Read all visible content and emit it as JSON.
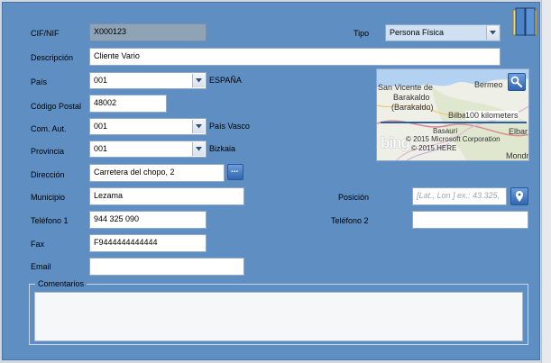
{
  "form": {
    "cif": {
      "label": "CIF/NIF",
      "value": "X000123"
    },
    "tipo": {
      "label": "Tipo",
      "value": "Persona Física"
    },
    "descripcion": {
      "label": "Descripción",
      "value": "Cliente Vario"
    },
    "pais": {
      "label": "País",
      "value": "001",
      "name": "ESPAÑA"
    },
    "codigo_postal": {
      "label": "Código Postal",
      "value": "48002"
    },
    "com_aut": {
      "label": "Com. Aut.",
      "value": "001",
      "name": "País Vasco"
    },
    "provincia": {
      "label": "Provincia",
      "value": "001",
      "name": "Bizkaia"
    },
    "direccion": {
      "label": "Dirección",
      "value": "Carretera del chopo, 2",
      "button": "..."
    },
    "municipio": {
      "label": "Municipio",
      "value": "Lezama"
    },
    "posicion": {
      "label": "Posición",
      "placeholder": "[Lat., Lon ] ex.: 43.325,"
    },
    "telefono1": {
      "label": "Teléfono 1",
      "value": "944 325 090"
    },
    "telefono2": {
      "label": "Teléfono 2",
      "value": ""
    },
    "fax": {
      "label": "Fax",
      "value": "F9444444444444"
    },
    "email": {
      "label": "Email",
      "value": ""
    },
    "comentarios": {
      "label": "Comentarios",
      "value": ""
    }
  },
  "map": {
    "places": [
      "San Vicente de",
      "Barakaldo",
      "(Barakaldo)",
      "Bermeo",
      "Bilbao",
      "Basauri",
      "Elbar",
      "Mondra"
    ],
    "scale": "100 kilometers",
    "logo": "bing",
    "copyright1": "© 2015 Microsoft Corporation",
    "copyright2": "© 2015 HERE"
  },
  "icons": {
    "open_book": "open-book-icon",
    "map_search": "magnifier-icon",
    "location_pin": "location-pin-icon"
  }
}
